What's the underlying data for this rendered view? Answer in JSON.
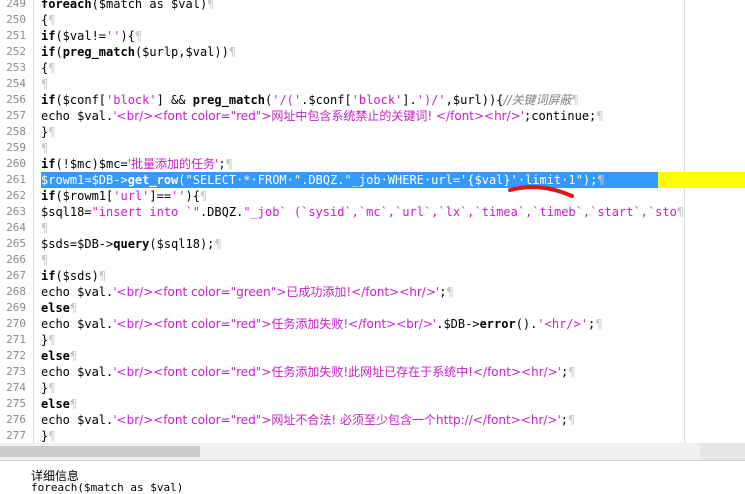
{
  "editor": {
    "eol_mark": "¶",
    "lines": [
      {
        "n": "249",
        "tokens": [
          {
            "t": "foreach",
            "c": "kw"
          },
          {
            "t": "($match as $val)"
          }
        ]
      },
      {
        "n": "250",
        "tokens": [
          {
            "t": "{"
          }
        ]
      },
      {
        "n": "251",
        "tokens": [
          {
            "t": "if",
            "c": "kw"
          },
          {
            "t": "($val!="
          },
          {
            "t": "''",
            "c": "str"
          },
          {
            "t": "){"
          }
        ]
      },
      {
        "n": "252",
        "tokens": [
          {
            "t": "if",
            "c": "kw"
          },
          {
            "t": "("
          },
          {
            "t": "preg_match",
            "c": "fn"
          },
          {
            "t": "($urlp,$val))"
          }
        ]
      },
      {
        "n": "253",
        "tokens": [
          {
            "t": "{"
          }
        ]
      },
      {
        "n": "254",
        "tokens": []
      },
      {
        "n": "256",
        "tokens": [
          {
            "t": "if",
            "c": "kw"
          },
          {
            "t": "($conf["
          },
          {
            "t": "'block'",
            "c": "str"
          },
          {
            "t": "] && "
          },
          {
            "t": "preg_match",
            "c": "fn"
          },
          {
            "t": "("
          },
          {
            "t": "'/('",
            "c": "str"
          },
          {
            "t": ".$conf["
          },
          {
            "t": "'block'",
            "c": "str"
          },
          {
            "t": "]."
          },
          {
            "t": "')/'",
            "c": "str"
          },
          {
            "t": ",$url)){"
          },
          {
            "t": "//关键词屏蔽",
            "c": "cm"
          }
        ]
      },
      {
        "n": "257",
        "tokens": [
          {
            "t": "echo $val."
          },
          {
            "t": "'<br/><font color=\"red\">网址中包含系统禁止的关键词! </font><hr/>'",
            "c": "str"
          },
          {
            "t": ";continue;"
          }
        ]
      },
      {
        "n": "258",
        "tokens": [
          {
            "t": "}"
          }
        ]
      },
      {
        "n": "259",
        "tokens": []
      },
      {
        "n": "260",
        "tokens": [
          {
            "t": "if",
            "c": "kw"
          },
          {
            "t": "(!$mc)$mc="
          },
          {
            "t": "'批量添加的任务'",
            "c": "str"
          },
          {
            "t": ";"
          }
        ]
      },
      {
        "n": "261",
        "sel": true,
        "tokens": [
          {
            "t": "$rowm1=$DB->"
          },
          {
            "t": "get_row",
            "c": "fn"
          },
          {
            "t": "(\"SELECT·*·FROM·\".DBQZ.\"_job·WHERE·url='{$val}'·limit·1\");"
          }
        ]
      },
      {
        "n": "262",
        "tokens": [
          {
            "t": "if",
            "c": "kw"
          },
          {
            "t": "($rowm1["
          },
          {
            "t": "'url'",
            "c": "str"
          },
          {
            "t": "]=="
          },
          {
            "t": "''",
            "c": "str"
          },
          {
            "t": "){"
          }
        ]
      },
      {
        "n": "263",
        "tokens": [
          {
            "t": "$sql18="
          },
          {
            "t": "\"insert into `\"",
            "c": "str"
          },
          {
            "t": ".DBQZ."
          },
          {
            "t": "\"_job` (`sysid`,`mc`,`url`,`lx`,`timea`,`timeb`,`start`,`sto",
            "c": "str"
          }
        ]
      },
      {
        "n": "264",
        "tokens": []
      },
      {
        "n": "265",
        "tokens": [
          {
            "t": "$sds=$DB->"
          },
          {
            "t": "query",
            "c": "fn"
          },
          {
            "t": "($sql18);"
          }
        ]
      },
      {
        "n": "266",
        "tokens": []
      },
      {
        "n": "267",
        "tokens": [
          {
            "t": "if",
            "c": "kw"
          },
          {
            "t": "($sds)"
          }
        ]
      },
      {
        "n": "268",
        "tokens": [
          {
            "t": "echo $val."
          },
          {
            "t": "'<br/><font color=\"green\">已成功添加!</font><hr/>'",
            "c": "str"
          },
          {
            "t": ";"
          }
        ]
      },
      {
        "n": "269",
        "tokens": [
          {
            "t": "else",
            "c": "kw"
          }
        ]
      },
      {
        "n": "270",
        "tokens": [
          {
            "t": "echo $val."
          },
          {
            "t": "'<br/><font color=\"red\">任务添加失败!</font><br/>'",
            "c": "str"
          },
          {
            "t": ".$DB->"
          },
          {
            "t": "error",
            "c": "fn"
          },
          {
            "t": "()."
          },
          {
            "t": "'<hr/>'",
            "c": "str"
          },
          {
            "t": ";"
          }
        ]
      },
      {
        "n": "271",
        "tokens": [
          {
            "t": "}"
          }
        ]
      },
      {
        "n": "272",
        "tokens": [
          {
            "t": "else",
            "c": "kw"
          }
        ]
      },
      {
        "n": "273",
        "tokens": [
          {
            "t": "echo $val."
          },
          {
            "t": "'<br/><font color=\"red\">任务添加失败!此网址已存在于系统中!</font><hr/>'",
            "c": "str"
          },
          {
            "t": ";"
          }
        ]
      },
      {
        "n": "274",
        "tokens": [
          {
            "t": "}"
          }
        ]
      },
      {
        "n": "275",
        "tokens": [
          {
            "t": "else",
            "c": "kw"
          }
        ]
      },
      {
        "n": "276",
        "tokens": [
          {
            "t": "echo $val."
          },
          {
            "t": "'<br/><font color=\"red\">网址不合法! 必须至少包含一个http://</font><hr/>'",
            "c": "str"
          },
          {
            "t": ";"
          }
        ]
      },
      {
        "n": "277",
        "tokens": [
          {
            "t": "}"
          }
        ]
      }
    ]
  },
  "details_panel": {
    "title": "详细信息",
    "text": "foreach($match as $val)"
  },
  "colors": {
    "string": "#c81ec8",
    "comment": "#7f7f7f",
    "selection": "#3399ff",
    "current_line": "#ffff00",
    "annotation": "#e01414"
  }
}
